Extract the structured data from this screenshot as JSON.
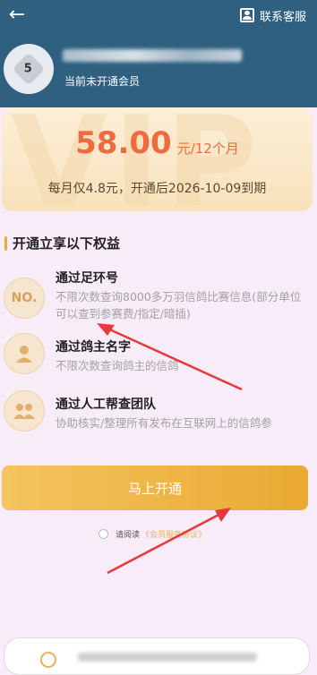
{
  "header": {
    "back_icon": "back-arrow-icon",
    "service_label": "联系客服",
    "service_icon": "contact-card-icon",
    "avatar_level": "5",
    "member_status": "当前未开通会员"
  },
  "vip": {
    "watermark": "VIP",
    "price": "58.00",
    "price_unit": "元/12个月",
    "note": "每月仅4.8元，开通后2026-10-09到期"
  },
  "benefits": {
    "title": "开通立享以下权益",
    "items": [
      {
        "icon_label": "NO.",
        "title": "通过足环号",
        "desc": "不限次数查询8000多万羽信鸽比赛信息(部分单位可以查到参赛费/指定/暗插)"
      },
      {
        "icon_label": "",
        "title": "通过鸽主名字",
        "desc": "不限次数查询鸽主的信鸽"
      },
      {
        "icon_label": "",
        "title": "通过人工帮查团队",
        "desc": "协助核实/整理所有发布在互联网上的信鸽参"
      }
    ]
  },
  "actions": {
    "open_label": "马上开通",
    "agree_prefix": "请阅读",
    "agree_link": "《会员服务协议》"
  },
  "colors": {
    "header_bg": "#2f607f",
    "price": "#ef6b3f",
    "accent": "#efa93b",
    "arrow": "#e8383d"
  }
}
